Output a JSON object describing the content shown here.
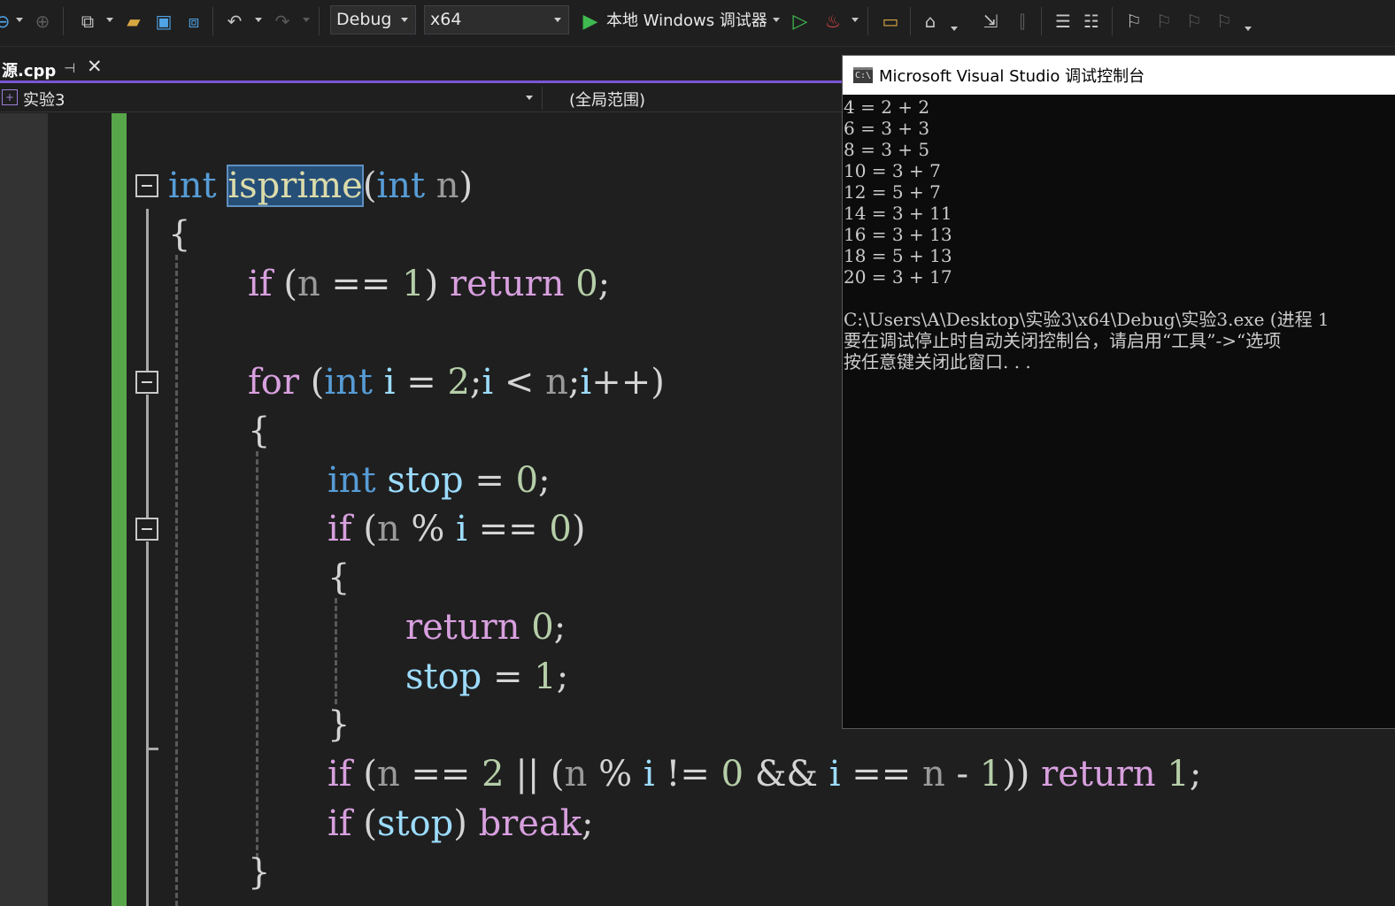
{
  "toolbar": {
    "configuration": "Debug",
    "platform": "x64",
    "run_label": "本地 Windows 调试器"
  },
  "document_tab": {
    "filename": "源.cpp",
    "pin_glyph": "⊣",
    "close_glyph": "✕"
  },
  "navbar": {
    "project": "实验3",
    "scope": "(全局范围)"
  },
  "code": {
    "lines": [
      [
        {
          "t": "int",
          "c": "kw-blue"
        },
        {
          "t": " "
        },
        {
          "t": "isprime",
          "c": "fn-hl"
        },
        {
          "t": "(",
          "c": "punc"
        },
        {
          "t": "int",
          "c": "kw-blue"
        },
        {
          "t": " "
        },
        {
          "t": "n",
          "c": "id-param"
        },
        {
          "t": ")",
          "c": "punc"
        }
      ],
      [
        {
          "t": "{",
          "c": "punc"
        }
      ],
      [
        {
          "t": "if",
          "c": "kw-purple"
        },
        {
          "t": " "
        },
        {
          "t": "(",
          "c": "punc"
        },
        {
          "t": "n",
          "c": "id-param"
        },
        {
          "t": " == ",
          "c": "punc"
        },
        {
          "t": "1",
          "c": "num"
        },
        {
          "t": ") ",
          "c": "punc"
        },
        {
          "t": "return",
          "c": "kw-purple"
        },
        {
          "t": " "
        },
        {
          "t": "0",
          "c": "num"
        },
        {
          "t": ";",
          "c": "punc"
        }
      ],
      [
        {
          "t": "for",
          "c": "kw-purple"
        },
        {
          "t": " "
        },
        {
          "t": "(",
          "c": "punc"
        },
        {
          "t": "int",
          "c": "kw-blue"
        },
        {
          "t": " "
        },
        {
          "t": "i",
          "c": "id-var"
        },
        {
          "t": " = ",
          "c": "punc"
        },
        {
          "t": "2",
          "c": "num"
        },
        {
          "t": ";",
          "c": "punc"
        },
        {
          "t": "i",
          "c": "id-var"
        },
        {
          "t": " < ",
          "c": "punc"
        },
        {
          "t": "n",
          "c": "id-param"
        },
        {
          "t": ";",
          "c": "punc"
        },
        {
          "t": "i",
          "c": "id-var"
        },
        {
          "t": "++)",
          "c": "punc"
        }
      ],
      [
        {
          "t": "{",
          "c": "punc"
        }
      ],
      [
        {
          "t": "int",
          "c": "kw-blue"
        },
        {
          "t": " "
        },
        {
          "t": "stop",
          "c": "id-var"
        },
        {
          "t": " = ",
          "c": "punc"
        },
        {
          "t": "0",
          "c": "num"
        },
        {
          "t": ";",
          "c": "punc"
        }
      ],
      [
        {
          "t": "if",
          "c": "kw-purple"
        },
        {
          "t": " "
        },
        {
          "t": "(",
          "c": "punc"
        },
        {
          "t": "n",
          "c": "id-param"
        },
        {
          "t": " % ",
          "c": "punc"
        },
        {
          "t": "i",
          "c": "id-var"
        },
        {
          "t": " == ",
          "c": "punc"
        },
        {
          "t": "0",
          "c": "num"
        },
        {
          "t": ")",
          "c": "punc"
        }
      ],
      [
        {
          "t": "{",
          "c": "punc"
        }
      ],
      [
        {
          "t": "return",
          "c": "kw-purple"
        },
        {
          "t": " "
        },
        {
          "t": "0",
          "c": "num"
        },
        {
          "t": ";",
          "c": "punc"
        }
      ],
      [
        {
          "t": "stop",
          "c": "id-var"
        },
        {
          "t": " = ",
          "c": "punc"
        },
        {
          "t": "1",
          "c": "num"
        },
        {
          "t": ";",
          "c": "punc"
        }
      ],
      [
        {
          "t": "}",
          "c": "punc"
        }
      ],
      [
        {
          "t": "if",
          "c": "kw-purple"
        },
        {
          "t": " "
        },
        {
          "t": "(",
          "c": "punc"
        },
        {
          "t": "n",
          "c": "id-param"
        },
        {
          "t": " == ",
          "c": "punc"
        },
        {
          "t": "2",
          "c": "num"
        },
        {
          "t": " || (",
          "c": "punc"
        },
        {
          "t": "n",
          "c": "id-param"
        },
        {
          "t": " % ",
          "c": "punc"
        },
        {
          "t": "i",
          "c": "id-var"
        },
        {
          "t": " != ",
          "c": "punc"
        },
        {
          "t": "0",
          "c": "num"
        },
        {
          "t": " && ",
          "c": "punc"
        },
        {
          "t": "i",
          "c": "id-var"
        },
        {
          "t": " == ",
          "c": "punc"
        },
        {
          "t": "n",
          "c": "id-param"
        },
        {
          "t": " - ",
          "c": "punc"
        },
        {
          "t": "1",
          "c": "num"
        },
        {
          "t": ")) ",
          "c": "punc"
        },
        {
          "t": "return",
          "c": "kw-purple"
        },
        {
          "t": " "
        },
        {
          "t": "1",
          "c": "num"
        },
        {
          "t": ";",
          "c": "punc"
        }
      ],
      [
        {
          "t": "if",
          "c": "kw-purple"
        },
        {
          "t": " "
        },
        {
          "t": "(",
          "c": "punc"
        },
        {
          "t": "stop",
          "c": "id-var"
        },
        {
          "t": ") ",
          "c": "punc"
        },
        {
          "t": "break",
          "c": "kw-purple"
        },
        {
          "t": ";",
          "c": "punc"
        }
      ],
      [
        {
          "t": "}",
          "c": "punc"
        }
      ]
    ]
  },
  "console": {
    "title": "Microsoft Visual Studio 调试控制台",
    "icon_text": "C:\\",
    "lines": [
      "4 = 2 + 2",
      "6 = 3 + 3",
      "8 = 3 + 5",
      "10 = 3 + 7",
      "12 = 5 + 7",
      "14 = 3 + 11",
      "16 = 3 + 13",
      "18 = 5 + 13",
      "20 = 3 + 17",
      "",
      "C:\\Users\\A\\Desktop\\实验3\\x64\\Debug\\实验3.exe (进程 1",
      "要在调试停止时自动关闭控制台，请启用“工具”->“选项",
      "按任意键关闭此窗口. . ."
    ]
  },
  "colors": {
    "editor_bg": "#1f1f1f",
    "keyword_blue": "#569cd6",
    "keyword_purple": "#d8a0df",
    "number": "#b5cea8",
    "variable": "#9cdcfe",
    "change_bar": "#57a64a",
    "tab_accent": "#7a56d4"
  }
}
